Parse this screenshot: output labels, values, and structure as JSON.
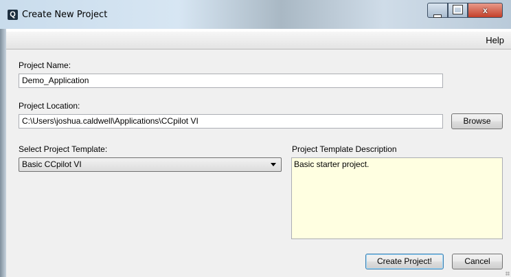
{
  "window": {
    "title": "Create New Project",
    "app_icon_glyph": "Q",
    "close_glyph": "x"
  },
  "menu": {
    "help_label": "Help"
  },
  "form": {
    "project_name_label": "Project Name:",
    "project_name_value": "Demo_Application",
    "project_location_label": "Project Location:",
    "project_location_value": "C:\\Users\\joshua.caldwell\\Applications\\CCpilot VI",
    "browse_label": "Browse",
    "template_label": "Select Project Template:",
    "template_selected": "Basic CCpilot VI",
    "description_label": "Project Template Description",
    "description_text": "Basic starter project."
  },
  "actions": {
    "create_label": "Create Project!",
    "cancel_label": "Cancel"
  },
  "colors": {
    "description_bg": "#ffffe1",
    "close_button": "#c4402a",
    "client_bg": "#f0f0f0"
  },
  "icons": {
    "app": "q-app-icon",
    "minimize": "minimize-icon",
    "maximize": "maximize-icon",
    "close": "close-icon",
    "dropdown": "chevron-down-icon",
    "resize": "resize-grip-icon"
  }
}
